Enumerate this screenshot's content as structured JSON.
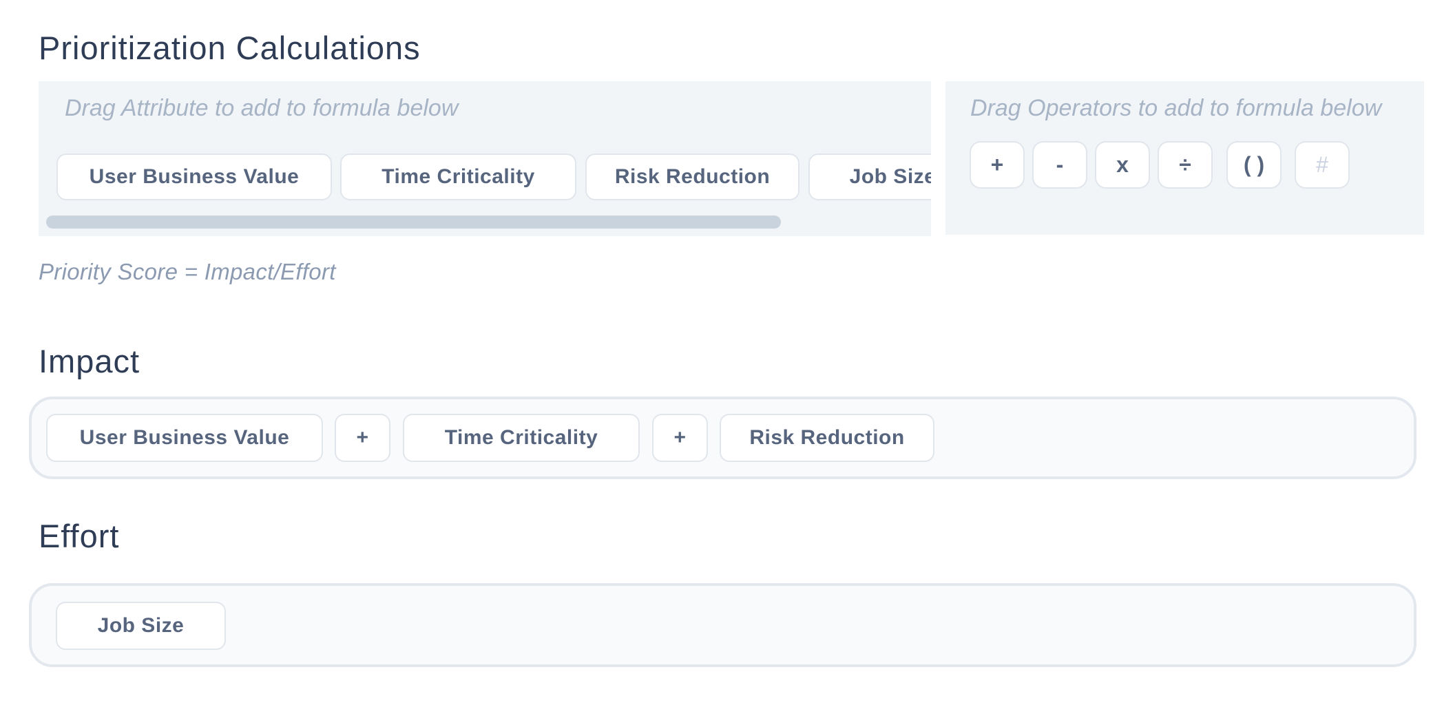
{
  "title": "Prioritization Calculations",
  "attributes_panel": {
    "hint": "Drag Attribute to add to formula below",
    "items": [
      "User Business Value",
      "Time Criticality",
      "Risk Reduction",
      "Job Size"
    ]
  },
  "operators_panel": {
    "hint": "Drag Operators to add to formula below",
    "items": [
      "+",
      "-",
      "x",
      "÷",
      "( )",
      "#"
    ]
  },
  "formula_note": "Priority Score = Impact/Effort",
  "impact": {
    "title": "Impact",
    "items": [
      "User Business Value",
      "+",
      "Time Criticality",
      "+",
      "Risk Reduction"
    ]
  },
  "effort": {
    "title": "Effort",
    "items": [
      "Job Size"
    ]
  }
}
